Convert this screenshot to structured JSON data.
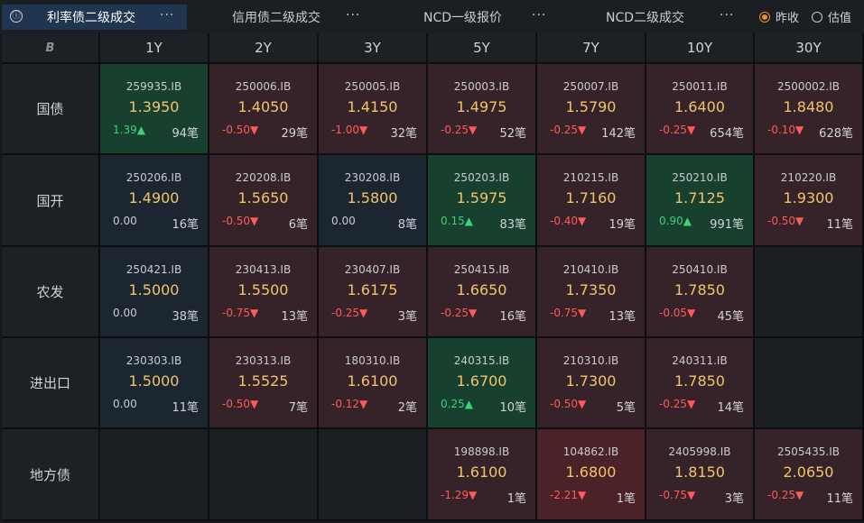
{
  "tabs": [
    {
      "label": "利率债二级成交",
      "active": true
    },
    {
      "label": "信用债二级成交",
      "active": false
    },
    {
      "label": "NCD一级报价",
      "active": false
    },
    {
      "label": "NCD二级成交",
      "active": false
    }
  ],
  "dots": "···",
  "info_icon": "ⓘ",
  "radios": [
    {
      "label": "昨收",
      "checked": true
    },
    {
      "label": "估值",
      "checked": false
    }
  ],
  "corner_label": "B",
  "columns": [
    "1Y",
    "2Y",
    "3Y",
    "5Y",
    "7Y",
    "10Y",
    "30Y"
  ],
  "rows": [
    {
      "label": "国债",
      "cells": [
        {
          "code": "259935.IB",
          "rate": "1.3950",
          "chg": "1.39▲",
          "dir": "up",
          "cnt": "94笔",
          "bg": "green"
        },
        {
          "code": "250006.IB",
          "rate": "1.4050",
          "chg": "-0.50▼",
          "dir": "down",
          "cnt": "29笔",
          "bg": "red"
        },
        {
          "code": "250005.IB",
          "rate": "1.4150",
          "chg": "-1.00▼",
          "dir": "down",
          "cnt": "32笔",
          "bg": "red"
        },
        {
          "code": "250003.IB",
          "rate": "1.4975",
          "chg": "-0.25▼",
          "dir": "down",
          "cnt": "52笔",
          "bg": "red"
        },
        {
          "code": "250007.IB",
          "rate": "1.5790",
          "chg": "-0.25▼",
          "dir": "down",
          "cnt": "142笔",
          "bg": "red"
        },
        {
          "code": "250011.IB",
          "rate": "1.6400",
          "chg": "-0.25▼",
          "dir": "down",
          "cnt": "654笔",
          "bg": "red"
        },
        {
          "code": "2500002.IB",
          "rate": "1.8480",
          "chg": "-0.10▼",
          "dir": "down",
          "cnt": "628笔",
          "bg": "red"
        }
      ]
    },
    {
      "label": "国开",
      "cells": [
        {
          "code": "250206.IB",
          "rate": "1.4900",
          "chg": "0.00",
          "dir": "flat",
          "cnt": "16笔",
          "bg": "blue"
        },
        {
          "code": "220208.IB",
          "rate": "1.5650",
          "chg": "-0.50▼",
          "dir": "down",
          "cnt": "6笔",
          "bg": "red"
        },
        {
          "code": "230208.IB",
          "rate": "1.5800",
          "chg": "0.00",
          "dir": "flat",
          "cnt": "8笔",
          "bg": "blue"
        },
        {
          "code": "250203.IB",
          "rate": "1.5975",
          "chg": "0.15▲",
          "dir": "up",
          "cnt": "83笔",
          "bg": "green"
        },
        {
          "code": "210215.IB",
          "rate": "1.7160",
          "chg": "-0.40▼",
          "dir": "down",
          "cnt": "19笔",
          "bg": "red"
        },
        {
          "code": "250210.IB",
          "rate": "1.7125",
          "chg": "0.90▲",
          "dir": "up",
          "cnt": "991笔",
          "bg": "green"
        },
        {
          "code": "210220.IB",
          "rate": "1.9300",
          "chg": "-0.50▼",
          "dir": "down",
          "cnt": "11笔",
          "bg": "red"
        }
      ]
    },
    {
      "label": "农发",
      "cells": [
        {
          "code": "250421.IB",
          "rate": "1.5000",
          "chg": "0.00",
          "dir": "flat",
          "cnt": "38笔",
          "bg": "blue"
        },
        {
          "code": "230413.IB",
          "rate": "1.5500",
          "chg": "-0.75▼",
          "dir": "down",
          "cnt": "13笔",
          "bg": "red"
        },
        {
          "code": "230407.IB",
          "rate": "1.6175",
          "chg": "-0.25▼",
          "dir": "down",
          "cnt": "3笔",
          "bg": "red"
        },
        {
          "code": "250415.IB",
          "rate": "1.6650",
          "chg": "-0.25▼",
          "dir": "down",
          "cnt": "16笔",
          "bg": "red"
        },
        {
          "code": "210410.IB",
          "rate": "1.7350",
          "chg": "-0.75▼",
          "dir": "down",
          "cnt": "13笔",
          "bg": "red"
        },
        {
          "code": "250410.IB",
          "rate": "1.7850",
          "chg": "-0.05▼",
          "dir": "down",
          "cnt": "45笔",
          "bg": "red"
        },
        null
      ]
    },
    {
      "label": "进出口",
      "cells": [
        {
          "code": "230303.IB",
          "rate": "1.5000",
          "chg": "0.00",
          "dir": "flat",
          "cnt": "11笔",
          "bg": "blue"
        },
        {
          "code": "230313.IB",
          "rate": "1.5525",
          "chg": "-0.50▼",
          "dir": "down",
          "cnt": "7笔",
          "bg": "red"
        },
        {
          "code": "180310.IB",
          "rate": "1.6100",
          "chg": "-0.12▼",
          "dir": "down",
          "cnt": "2笔",
          "bg": "red"
        },
        {
          "code": "240315.IB",
          "rate": "1.6700",
          "chg": "0.25▲",
          "dir": "up",
          "cnt": "10笔",
          "bg": "green"
        },
        {
          "code": "210310.IB",
          "rate": "1.7300",
          "chg": "-0.50▼",
          "dir": "down",
          "cnt": "5笔",
          "bg": "red"
        },
        {
          "code": "240311.IB",
          "rate": "1.7850",
          "chg": "-0.25▼",
          "dir": "down",
          "cnt": "14笔",
          "bg": "red"
        },
        null
      ]
    },
    {
      "label": "地方债",
      "cells": [
        null,
        null,
        null,
        {
          "code": "198898.IB",
          "rate": "1.6100",
          "chg": "-1.29▼",
          "dir": "down",
          "cnt": "1笔",
          "bg": "red"
        },
        {
          "code": "104862.IB",
          "rate": "1.6800",
          "chg": "-2.21▼",
          "dir": "down",
          "cnt": "1笔",
          "bg": "red2"
        },
        {
          "code": "2405998.IB",
          "rate": "1.8150",
          "chg": "-0.75▼",
          "dir": "down",
          "cnt": "3笔",
          "bg": "red"
        },
        {
          "code": "2505435.IB",
          "rate": "2.0650",
          "chg": "-0.25▼",
          "dir": "down",
          "cnt": "11笔",
          "bg": "red"
        }
      ]
    }
  ]
}
